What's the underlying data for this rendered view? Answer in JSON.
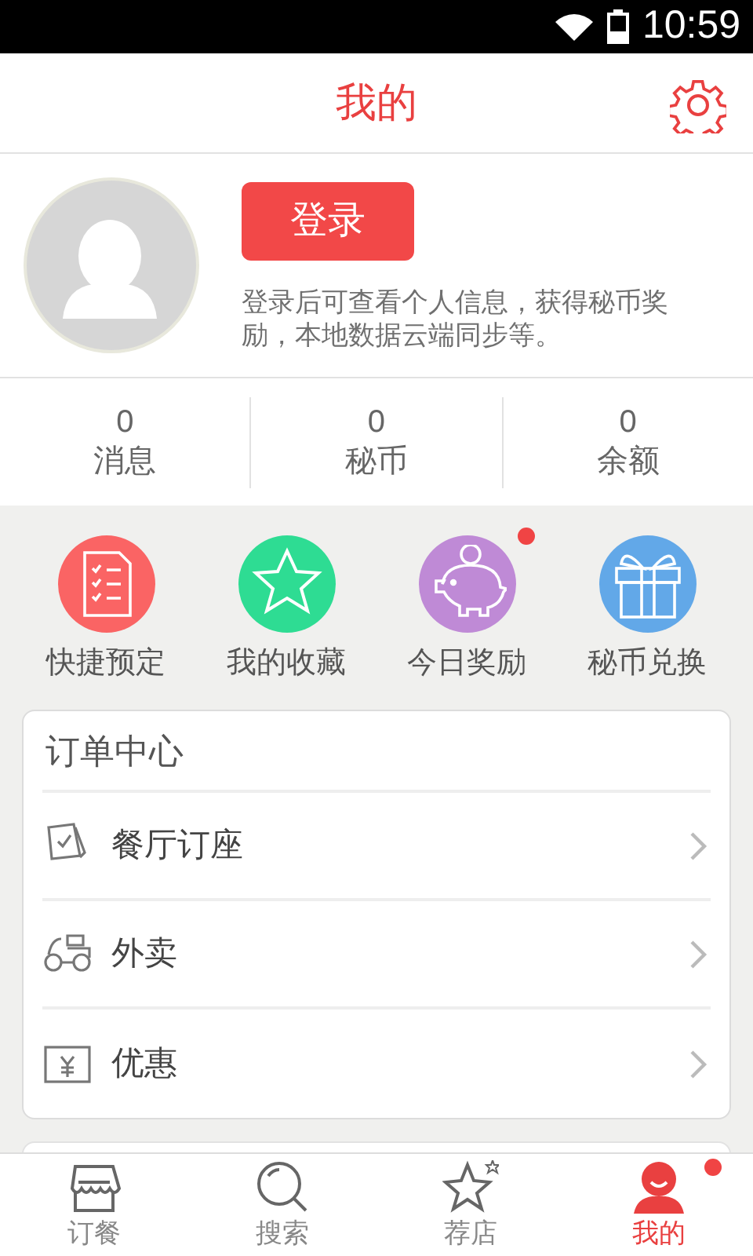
{
  "status_bar": {
    "time": "10:59"
  },
  "header": {
    "title": "我的"
  },
  "profile": {
    "login_button": "登录",
    "hint": "登录后可查看个人信息，获得秘币奖励，本地数据云端同步等。"
  },
  "stats": [
    {
      "value": "0",
      "label": "消息"
    },
    {
      "value": "0",
      "label": "秘币"
    },
    {
      "value": "0",
      "label": "余额"
    }
  ],
  "shortcuts": [
    {
      "kind": "checklist",
      "label": "快捷预定",
      "color": "#fa6464",
      "badge": false
    },
    {
      "kind": "star",
      "label": "我的收藏",
      "color": "#2edc93",
      "badge": false
    },
    {
      "kind": "piggy",
      "label": "今日奖励",
      "color": "#bf8ad6",
      "badge": true
    },
    {
      "kind": "gift",
      "label": "秘币兑换",
      "color": "#62a8e8",
      "badge": false
    }
  ],
  "order_center": {
    "title": "订单中心",
    "items": [
      {
        "kind": "seat",
        "label": "餐厅订座"
      },
      {
        "kind": "delivery",
        "label": "外卖"
      },
      {
        "kind": "coupon",
        "label": "优惠"
      }
    ]
  },
  "bottom_nav": [
    {
      "kind": "shop",
      "label": "订餐",
      "selected": false,
      "badge": false
    },
    {
      "kind": "search",
      "label": "搜索",
      "selected": false,
      "badge": false
    },
    {
      "kind": "star",
      "label": "荐店",
      "selected": false,
      "badge": false
    },
    {
      "kind": "user",
      "label": "我的",
      "selected": true,
      "badge": true
    }
  ]
}
